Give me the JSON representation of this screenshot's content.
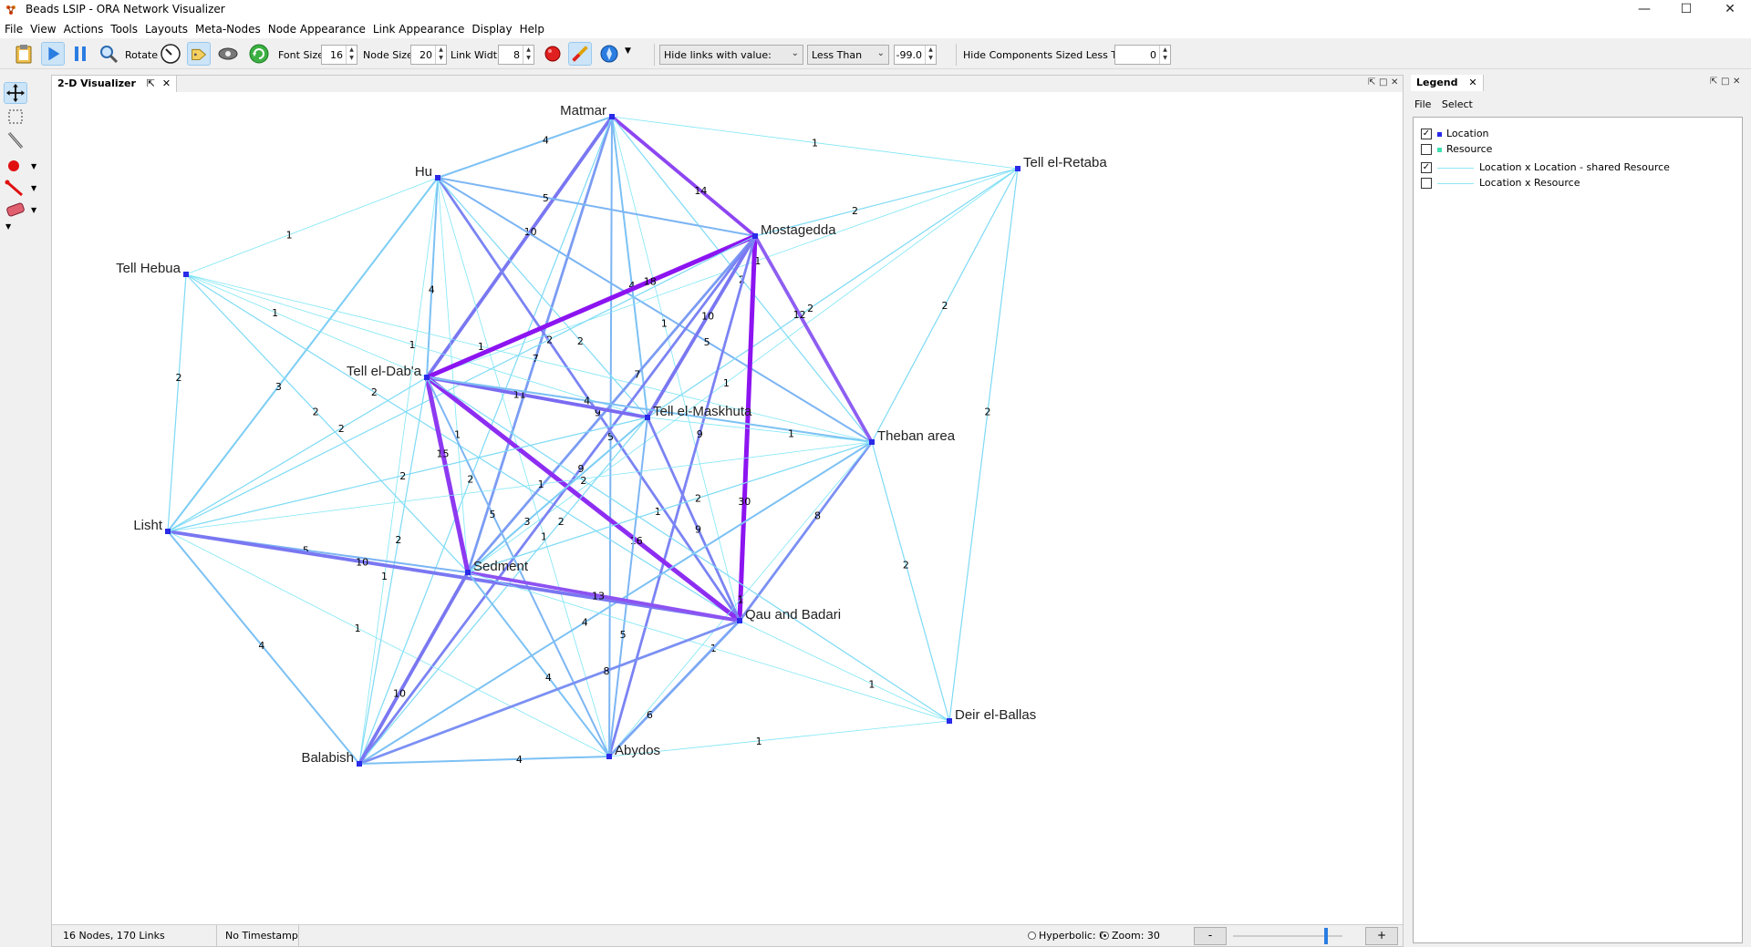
{
  "window": {
    "title": "Beads LSIP - ORA Network Visualizer",
    "minimize": "—",
    "maximize": "☐",
    "close": "✕"
  },
  "menu": [
    "File",
    "View",
    "Actions",
    "Tools",
    "Layouts",
    "Meta-Nodes",
    "Node Appearance",
    "Link Appearance",
    "Display",
    "Help"
  ],
  "toolbar": {
    "rotate_label": "Rotate",
    "font_size_label": "Font Size",
    "font_size": "16",
    "node_size_label": "Node Size",
    "node_size": "20",
    "link_width_label": "Link Width",
    "link_width": "8",
    "hide_links_select": "Hide links with value:",
    "comparison_select": "Less Than",
    "threshold": "-99.0",
    "hide_components_label": "Hide Components Sized Less Than",
    "hide_components": "0"
  },
  "visualizer": {
    "tab_label": "2-D Visualizer",
    "status_counts": "16 Nodes, 170 Links",
    "status_timestamp": "No Timestamp",
    "hyperbolic_label": "Hyperbolic: 0",
    "zoom_label": "Zoom: 30",
    "zoom_minus": "-",
    "zoom_plus": "+"
  },
  "legend": {
    "tab_label": "Legend",
    "menu": [
      "File",
      "Select"
    ],
    "items": [
      {
        "label": "Location",
        "checked": true,
        "color": "#2a2ae8",
        "kind": "node"
      },
      {
        "label": "Resource",
        "checked": false,
        "color": "#40e0b0",
        "kind": "node"
      },
      {
        "label": "Location x Location - shared Resource",
        "checked": true,
        "color": "#8ee7f3",
        "kind": "link"
      },
      {
        "label": "Location x Resource",
        "checked": false,
        "color": "#8ee7f3",
        "kind": "link"
      }
    ]
  },
  "graph": {
    "nodes": [
      {
        "id": "matmar",
        "label": "Matmar"
      },
      {
        "id": "hu",
        "label": "Hu"
      },
      {
        "id": "retaba",
        "label": "Tell el-Retaba"
      },
      {
        "id": "mostagedda",
        "label": "Mostagedda"
      },
      {
        "id": "hebua",
        "label": "Tell Hebua"
      },
      {
        "id": "daba",
        "label": "Tell el-Dab'a"
      },
      {
        "id": "maskhuta",
        "label": "Tell el-Maskhuta"
      },
      {
        "id": "theban",
        "label": "Theban area"
      },
      {
        "id": "lisht",
        "label": "Lisht"
      },
      {
        "id": "sedment",
        "label": "Sedment"
      },
      {
        "id": "qau",
        "label": "Qau and Badari"
      },
      {
        "id": "deir",
        "label": "Deir el-Ballas"
      },
      {
        "id": "balabish",
        "label": "Balabish"
      },
      {
        "id": "abydos",
        "label": "Abydos"
      }
    ],
    "links": [
      [
        "hu",
        "matmar",
        "4"
      ],
      [
        "matmar",
        "retaba",
        "1"
      ],
      [
        "matmar",
        "mostagedda",
        "14"
      ],
      [
        "matmar",
        "daba",
        "10"
      ],
      [
        "matmar",
        "theban",
        "2"
      ],
      [
        "matmar",
        "qau",
        "1"
      ],
      [
        "matmar",
        "sedment",
        "7"
      ],
      [
        "matmar",
        "maskhuta",
        "4"
      ],
      [
        "matmar",
        "abydos",
        "5"
      ],
      [
        "matmar",
        "balabish",
        "2"
      ],
      [
        "hu",
        "mostagedda",
        "5"
      ],
      [
        "hu",
        "hebua",
        "1"
      ],
      [
        "hu",
        "daba",
        "4"
      ],
      [
        "hu",
        "qau",
        "9"
      ],
      [
        "hu",
        "theban",
        "5"
      ],
      [
        "hu",
        "sedment",
        "1"
      ],
      [
        "hu",
        "abydos",
        "1"
      ],
      [
        "hu",
        "maskhuta",
        "2"
      ],
      [
        "hu",
        "balabish",
        "1"
      ],
      [
        "hu",
        "lisht",
        "3"
      ],
      [
        "retaba",
        "mostagedda",
        "2"
      ],
      [
        "retaba",
        "theban",
        "2"
      ],
      [
        "retaba",
        "sedment",
        "1"
      ],
      [
        "retaba",
        "daba",
        "1"
      ],
      [
        "retaba",
        "deir",
        "2"
      ],
      [
        "retaba",
        "maskhuta",
        "2"
      ],
      [
        "hebua",
        "lisht",
        "2"
      ],
      [
        "hebua",
        "daba",
        "1"
      ],
      [
        "hebua",
        "maskhuta",
        "1"
      ],
      [
        "hebua",
        "sedment",
        "2"
      ],
      [
        "hebua",
        "qau",
        "2"
      ],
      [
        "hebua",
        "theban",
        "1"
      ],
      [
        "mostagedda",
        "daba",
        "18"
      ],
      [
        "mostagedda",
        "qau",
        "30"
      ],
      [
        "mostagedda",
        "theban",
        "12"
      ],
      [
        "mostagedda",
        "sedment",
        "7"
      ],
      [
        "mostagedda",
        "maskhuta",
        "10"
      ],
      [
        "mostagedda",
        "lisht",
        "2"
      ],
      [
        "mostagedda",
        "balabish",
        "9"
      ],
      [
        "mostagedda",
        "abydos",
        "9"
      ],
      [
        "daba",
        "maskhuta",
        "11"
      ],
      [
        "daba",
        "theban",
        "4"
      ],
      [
        "daba",
        "qau",
        "16"
      ],
      [
        "daba",
        "sedment",
        "15"
      ],
      [
        "daba",
        "balabish",
        "2"
      ],
      [
        "daba",
        "lisht",
        "2"
      ],
      [
        "daba",
        "abydos",
        "5"
      ],
      [
        "maskhuta",
        "theban",
        "1"
      ],
      [
        "maskhuta",
        "sedment",
        "3"
      ],
      [
        "maskhuta",
        "qau",
        "9"
      ],
      [
        "maskhuta",
        "abydos",
        "5"
      ],
      [
        "maskhuta",
        "balabish",
        "2"
      ],
      [
        "theban",
        "sedment",
        "1"
      ],
      [
        "theban",
        "qau",
        "8"
      ],
      [
        "theban",
        "balabish",
        "4"
      ],
      [
        "theban",
        "abydos",
        "1"
      ],
      [
        "theban",
        "lisht",
        "1"
      ],
      [
        "theban",
        "deir",
        "2"
      ],
      [
        "lisht",
        "sedment",
        "5"
      ],
      [
        "lisht",
        "qau",
        "10"
      ],
      [
        "lisht",
        "balabish",
        "4"
      ],
      [
        "lisht",
        "maskhuta",
        "2"
      ],
      [
        "lisht",
        "abydos",
        "1"
      ],
      [
        "sedment",
        "qau",
        "13"
      ],
      [
        "sedment",
        "abydos",
        "4"
      ],
      [
        "sedment",
        "balabish",
        "10"
      ],
      [
        "sedment",
        "deir",
        "1"
      ],
      [
        "qau",
        "balabish",
        "8"
      ],
      [
        "qau",
        "abydos",
        "6"
      ],
      [
        "qau",
        "deir",
        "1"
      ],
      [
        "balabish",
        "abydos",
        "4"
      ],
      [
        "abydos",
        "deir",
        "1"
      ],
      [
        "sedment",
        "theban",
        "2"
      ],
      [
        "daba",
        "deir",
        "2"
      ]
    ]
  }
}
